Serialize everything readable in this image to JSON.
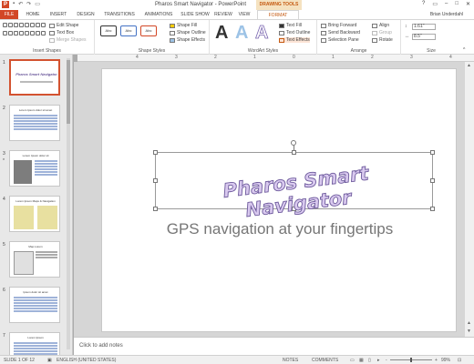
{
  "titlebar": {
    "app_icon": "P",
    "title": "Pharos Smart Navigator - PowerPoint",
    "quick_access": [
      "save-icon",
      "undo-icon",
      "redo-icon",
      "start-from-beginning-icon"
    ],
    "win_controls": [
      "?",
      "▭",
      "–",
      "□",
      "✕"
    ]
  },
  "tabs": {
    "contextual_header": "DRAWING TOOLS",
    "items": [
      "FILE",
      "HOME",
      "INSERT",
      "DESIGN",
      "TRANSITIONS",
      "ANIMATIONS",
      "SLIDE SHOW",
      "REVIEW",
      "VIEW",
      "FORMAT"
    ],
    "active": "FORMAT",
    "user_name": "Brian Underdahl"
  },
  "ribbon": {
    "insert_shapes": {
      "label": "Insert Shapes",
      "edit_shape": "Edit Shape",
      "text_box": "Text Box",
      "merge_shapes": "Merge Shapes"
    },
    "shape_styles": {
      "label": "Shape Styles",
      "style_samples": [
        "Abc",
        "Abc",
        "Abc"
      ],
      "shape_fill": "Shape Fill",
      "shape_outline": "Shape Outline",
      "shape_effects": "Shape Effects"
    },
    "wordart_styles": {
      "label": "WordArt Styles",
      "samples": [
        "A",
        "A",
        "A"
      ],
      "text_fill": "Text Fill",
      "text_outline": "Text Outline",
      "text_effects": "Text Effects"
    },
    "arrange": {
      "label": "Arrange",
      "bring_forward": "Bring Forward",
      "send_backward": "Send Backward",
      "selection_pane": "Selection Pane",
      "align": "Align",
      "group": "Group",
      "rotate": "Rotate"
    },
    "size": {
      "label": "Size",
      "height": "1.61\"",
      "width": "8.5\""
    }
  },
  "ruler": {
    "numbers": [
      "4",
      "3",
      "2",
      "1",
      "0",
      "1",
      "2",
      "3",
      "4"
    ]
  },
  "thumbnails": {
    "slides": [
      {
        "num": "1",
        "title": "Pharos Smart Navigator",
        "kind": "title",
        "selected": true
      },
      {
        "num": "2",
        "title": "Lorem Ipsum dolor sit amet",
        "kind": "bullets"
      },
      {
        "num": "3",
        "title": "Lorem Ipsum dolor sit",
        "kind": "image-bullets"
      },
      {
        "num": "4",
        "title": "Lorem Ipsum Maps & Navigation",
        "kind": "images"
      },
      {
        "num": "5",
        "title": "Map Lorem",
        "kind": "image-bullets"
      },
      {
        "num": "6",
        "title": "Ipsum dolor sit amet",
        "kind": "bullets"
      },
      {
        "num": "7",
        "title": "Lorem Ipsum",
        "kind": "bullets"
      }
    ]
  },
  "slide": {
    "title": "Pharos Smart Navigator",
    "subtitle": "GPS navigation at your fingertips"
  },
  "notes": {
    "placeholder": "Click to add notes"
  },
  "status": {
    "slide_info": "SLIDE 1 OF 12",
    "language": "ENGLISH (UNITED STATES)",
    "notes": "NOTES",
    "comments": "COMMENTS",
    "zoom_minus": "-",
    "zoom_plus": "+",
    "zoom": "99%"
  },
  "colors": {
    "accent": "#d24726",
    "format_tab": "#c55a11",
    "wordart_fill": "#d9c9ef",
    "wordart_outline": "#6d5a9c"
  }
}
